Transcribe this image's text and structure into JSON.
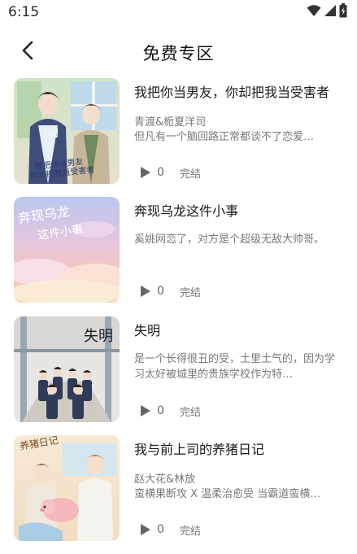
{
  "status_bar": {
    "time": "6:15",
    "icons": [
      "wifi-icon",
      "signal-icon",
      "battery-icon"
    ]
  },
  "header": {
    "back_icon": "chevron-left-icon",
    "title": "免费专区"
  },
  "colors": {
    "text_primary": "#1a1a1a",
    "text_secondary": "#7a7a7a",
    "icon": "#555555"
  },
  "books": [
    {
      "title": "我把你当男友，你却把我当受害者",
      "author": "青渡&栀夏洋司",
      "description": "但凡有一个脑回路正常都谈不了恋爱…",
      "play_count": "0",
      "status": "完结"
    },
    {
      "title": "奔现乌龙这件小事",
      "author": "",
      "description": "奚姚网恋了，对方是个超级无敌大帅哥。",
      "play_count": "0",
      "status": "完结"
    },
    {
      "title": "失明",
      "author": "",
      "description": "是一个长得很丑的受，土里土气的，因为学习太好被城里的贵族学校作为特…",
      "play_count": "0",
      "status": "完结"
    },
    {
      "title": "我与前上司的养猪日记",
      "author": "赵大花&林放",
      "description": "蛮横果断攻 X 温柔治愈受 当霸道蛮横…",
      "play_count": "0",
      "status": "完结"
    }
  ]
}
